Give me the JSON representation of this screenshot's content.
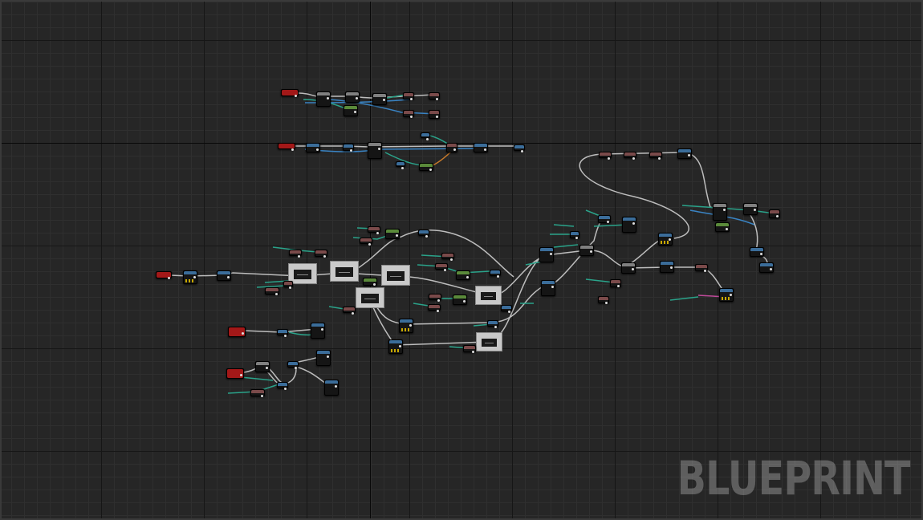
{
  "editor": {
    "graph_type_watermark": "BLUEPRINT"
  },
  "colors": {
    "background": "#262626",
    "event_header": "#a31818",
    "function_header": "#3b6d9a",
    "pure_header": "#5a8a3a",
    "exec_wire": "#c8c8c8",
    "data_wire": "#2aa38a",
    "object_wire": "#3a84c4",
    "pink_wire": "#c04a9a"
  },
  "graph": {
    "node_count_label": "",
    "icons": {
      "exec_pin": "exec-pin-icon",
      "data_pin": "data-pin-icon"
    }
  }
}
